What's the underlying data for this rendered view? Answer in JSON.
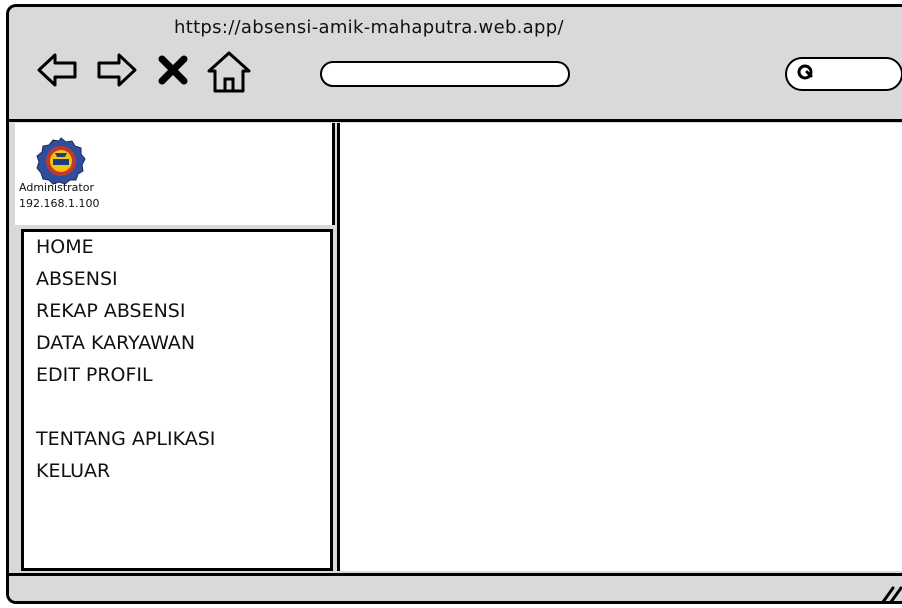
{
  "browser": {
    "url": "https://absensi-amik-mahaputra.web.app/",
    "address_value": "",
    "search_value": ""
  },
  "sidebar": {
    "user_role": "Administrator",
    "ip_address": "192.168.1.100",
    "menu": [
      {
        "label": "HOME"
      },
      {
        "label": "ABSENSI"
      },
      {
        "label": "REKAP ABSENSI"
      },
      {
        "label": "DATA KARYAWAN"
      },
      {
        "label": "EDIT PROFIL"
      },
      {
        "label": "TENTANG APLIKASI"
      },
      {
        "label": "KELUAR"
      }
    ]
  },
  "icons": {
    "back": "arrow-left-icon",
    "forward": "arrow-right-icon",
    "stop": "close-icon",
    "home": "home-icon",
    "search": "search-icon",
    "logo": "logo-icon",
    "resize": "resize-grip-icon"
  },
  "colors": {
    "chrome": "#d9d9d9",
    "border": "#000000",
    "panel": "#ffffff"
  }
}
